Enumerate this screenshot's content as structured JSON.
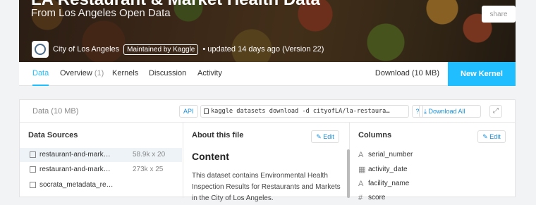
{
  "hero": {
    "title": "LA Restaurant & Market Health Data",
    "subtitle": "From Los Angeles Open Data",
    "owner": "City of Los Angeles",
    "maintained_badge": "Maintained by Kaggle",
    "updated": "• updated 14 days ago (Version 22)",
    "share_label": "share"
  },
  "nav": {
    "tabs": [
      {
        "label": "Data",
        "count": ""
      },
      {
        "label": "Overview",
        "count": "(1)"
      },
      {
        "label": "Kernels",
        "count": ""
      },
      {
        "label": "Discussion",
        "count": ""
      },
      {
        "label": "Activity",
        "count": ""
      }
    ],
    "download_label": "Download (10 MB)",
    "new_kernel_label": "New Kernel"
  },
  "data_panel": {
    "title": "Data (10 MB)",
    "api_label": "API",
    "command": "kaggle datasets download -d cityofLA/la-restaura…",
    "help_label": "?",
    "download_all_label": "Download All",
    "expand_icon": "expand-icon"
  },
  "sources": {
    "heading": "Data Sources",
    "items": [
      {
        "name": "restaurant-and-mark…",
        "meta": "58.9k x 20"
      },
      {
        "name": "restaurant-and-mark…",
        "meta": "273k x 25"
      },
      {
        "name": "socrata_metadata_re…",
        "meta": ""
      }
    ]
  },
  "about": {
    "heading": "About this file",
    "edit_label": "Edit",
    "content_heading": "Content",
    "content_text": "This dataset contains Environmental Health Inspection Results for Restaurants and Markets in the City of Los Angeles."
  },
  "columns": {
    "heading": "Columns",
    "edit_label": "Edit",
    "items": [
      {
        "name": "serial_number",
        "icon": "A"
      },
      {
        "name": "activity_date",
        "icon": "▦"
      },
      {
        "name": "facility_name",
        "icon": "A"
      },
      {
        "name": "score",
        "icon": "#"
      }
    ]
  }
}
